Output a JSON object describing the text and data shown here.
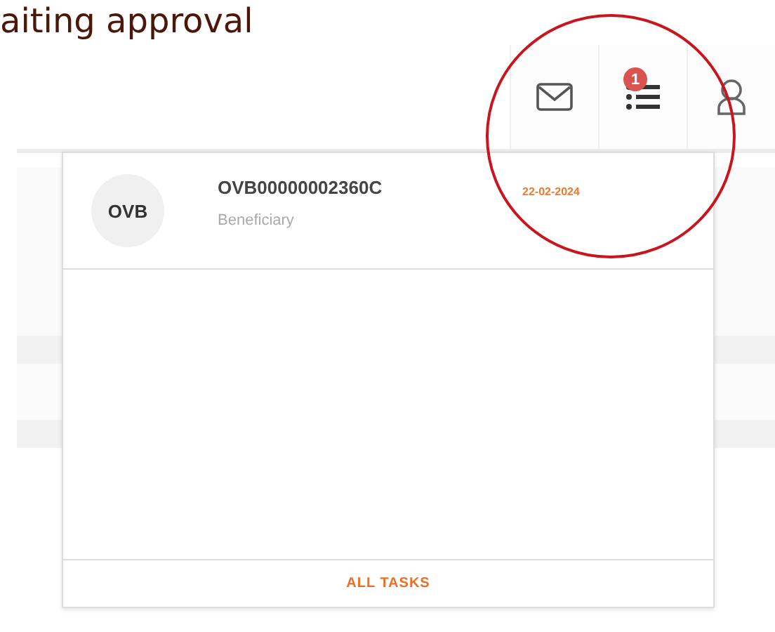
{
  "page_title": "aiting approval",
  "toolbar": {
    "task_badge": "1"
  },
  "tasks_dropdown": {
    "items": [
      {
        "avatar": "OVB",
        "reference": "OVB00000002360C",
        "role": "Beneficiary",
        "date": "22-02-2024"
      }
    ],
    "footer_link": "ALL TASKS"
  }
}
